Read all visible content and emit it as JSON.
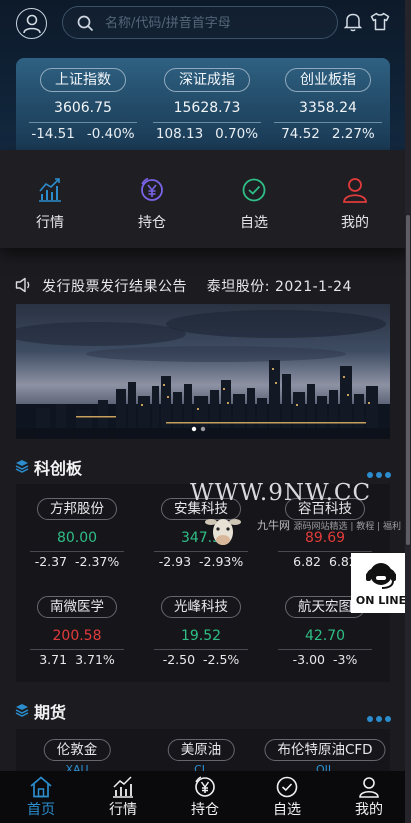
{
  "header": {
    "search_placeholder": "名称/代码/拼音首字母"
  },
  "indices": [
    {
      "name": "上证指数",
      "value": "3606.75",
      "change": "-14.51",
      "percent": "-0.40%"
    },
    {
      "name": "深证成指",
      "value": "15628.73",
      "change": "108.13",
      "percent": "0.70%"
    },
    {
      "name": "创业板指",
      "value": "3358.24",
      "change": "74.52",
      "percent": "2.27%"
    }
  ],
  "quick": [
    {
      "label": "行情",
      "icon": "market-chart-icon",
      "color": "#2b8dce"
    },
    {
      "label": "持仓",
      "icon": "yen-position-icon",
      "color": "#7b63e6"
    },
    {
      "label": "自选",
      "icon": "check-circle-icon",
      "color": "#2fbe86"
    },
    {
      "label": "我的",
      "icon": "user-icon",
      "color": "#e13b3b"
    }
  ],
  "notice": {
    "text": "发行股票发行结果公告    泰坦股份: 2021-1-24"
  },
  "sections": {
    "star": "科创板",
    "futures": "期货"
  },
  "star_stocks": [
    {
      "name": "方邦股份",
      "price": "80.00",
      "change": "-2.37",
      "percent": "-2.37%",
      "dir": "down"
    },
    {
      "name": "安集科技",
      "price": "347.5",
      "change": "-2.93",
      "percent": "-2.93%",
      "dir": "down"
    },
    {
      "name": "容百科技",
      "price": "89.69",
      "change": "6.82",
      "percent": "6.82",
      "dir": "up"
    },
    {
      "name": "南微医学",
      "price": "200.58",
      "change": "3.71",
      "percent": "3.71%",
      "dir": "up"
    },
    {
      "name": "光峰科技",
      "price": "19.52",
      "change": "-2.50",
      "percent": "-2.5%",
      "dir": "down"
    },
    {
      "name": "航天宏图",
      "price": "42.70",
      "change": "-3.00",
      "percent": "-3%",
      "dir": "down"
    }
  ],
  "futures": [
    {
      "name": "伦敦金",
      "code": "XAU"
    },
    {
      "name": "美原油",
      "code": "CL"
    },
    {
      "name": "布伦特原油CFD",
      "code": "OIL"
    }
  ],
  "watermark": {
    "site": "WWW.9NW.CC",
    "brand": "九牛网",
    "brand_sub": "源码网站精选 | 教程 | 福利"
  },
  "online_badge": "ON LINE",
  "bottom_nav": [
    {
      "label": "首页",
      "icon": "home-icon",
      "active": true
    },
    {
      "label": "行情",
      "icon": "market-chart-icon",
      "active": false
    },
    {
      "label": "持仓",
      "icon": "yen-position-icon",
      "active": false
    },
    {
      "label": "自选",
      "icon": "check-circle-icon",
      "active": false
    },
    {
      "label": "我的",
      "icon": "user-icon",
      "active": false
    }
  ],
  "colors": {
    "up": "#e13b3b",
    "down": "#2fbe86",
    "accent": "#2b8dce"
  }
}
